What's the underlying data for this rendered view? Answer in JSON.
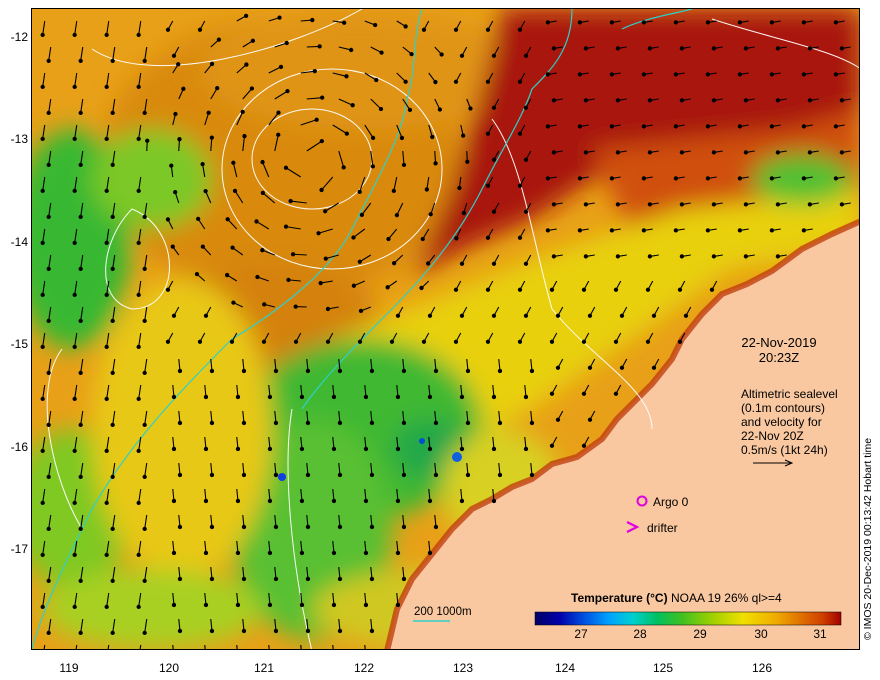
{
  "map": {
    "title_lines": [
      "22-Nov-2019",
      "20:23Z"
    ],
    "legend_text": [
      "Altimetric sealevel",
      "(0.1m contours)",
      "and velocity for",
      "22-Nov 20Z",
      "0.5m/s (1kt 24h)"
    ],
    "argo_label": "Argo 0",
    "drifter_label": "drifter",
    "isobath_label": "200  1000m",
    "credit": "© IMOS 20-Dec-2019 00:13:42 Hobart time",
    "colorbar": {
      "title_bold": "Temperature (°C)",
      "title_rest": "NOAA 19 26% ql>=4",
      "ticks": [
        "27",
        "28",
        "29",
        "30",
        "31"
      ],
      "colors": [
        "#000066",
        "#0000aa",
        "#0050e0",
        "#00a0ff",
        "#00d0d0",
        "#00c060",
        "#40c020",
        "#a0d000",
        "#f0e000",
        "#f0b000",
        "#e07000",
        "#d04000",
        "#a00000"
      ]
    },
    "y_ticks": [
      "-12",
      "-13",
      "-14",
      "-15",
      "-16",
      "-17"
    ],
    "x_ticks": [
      "119",
      "120",
      "121",
      "122",
      "123",
      "124",
      "125",
      "126"
    ],
    "colors": {
      "land": "#f9c8a0",
      "isobath": "#2ed0c8",
      "contour": "#ffffff",
      "argo": "#e000e0",
      "drifter": "#e000e0"
    }
  }
}
